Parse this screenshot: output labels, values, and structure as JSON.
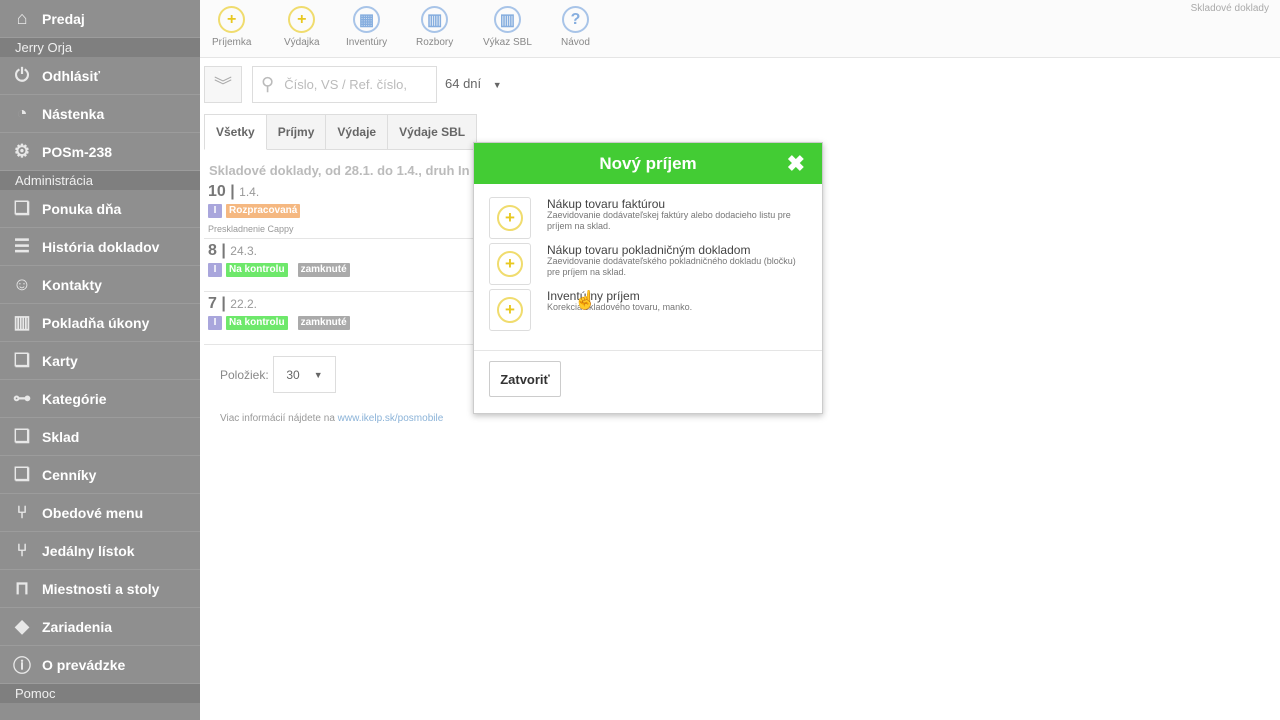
{
  "sidebar": {
    "items": [
      {
        "label": "Predaj",
        "icon": "home-icon"
      },
      {
        "sub": "Jerry Orja"
      },
      {
        "label": "Odhlásiť",
        "icon": "power-icon"
      },
      {
        "label": "Nástenka",
        "icon": "dashboard-icon"
      },
      {
        "label": "POSm-238",
        "icon": "gear-icon"
      },
      {
        "sub": "Administrácia"
      },
      {
        "label": "Ponuka dňa",
        "icon": "boxes-star-icon"
      },
      {
        "label": "História dokladov",
        "icon": "list-icon"
      },
      {
        "label": "Kontakty",
        "icon": "users-icon"
      },
      {
        "label": "Pokladňa úkony",
        "icon": "bars-icon"
      },
      {
        "label": "Karty",
        "icon": "boxes-icon"
      },
      {
        "label": "Kategórie",
        "icon": "tree-icon"
      },
      {
        "label": "Sklad",
        "icon": "boxes-icon"
      },
      {
        "label": "Cenníky",
        "icon": "boxes-icon"
      },
      {
        "label": "Obedové menu",
        "icon": "cutlery-icon"
      },
      {
        "label": "Jedálny lístok",
        "icon": "cutlery-icon"
      },
      {
        "label": "Miestnosti a stoly",
        "icon": "table-icon"
      },
      {
        "label": "Zariadenia",
        "icon": "diamond-icon"
      },
      {
        "label": "O prevádzke",
        "icon": "info-icon"
      },
      {
        "sub": "Pomoc"
      }
    ]
  },
  "toolbar": {
    "buttons": [
      {
        "label": "Príjemka",
        "glyph": "+",
        "color": "yellow"
      },
      {
        "label": "Výdajka",
        "glyph": "+",
        "color": "yellow"
      },
      {
        "label": "Inventúry",
        "glyph": "▦",
        "color": "blue"
      },
      {
        "label": "Rozbory",
        "glyph": "▥",
        "color": "blue"
      },
      {
        "label": "Výkaz SBL",
        "glyph": "▥",
        "color": "blue"
      },
      {
        "label": "Návod",
        "glyph": "?",
        "color": "blue"
      }
    ],
    "page_title": "Skladové doklady"
  },
  "filter": {
    "search_placeholder": "Číslo, VS / Ref. číslo,",
    "period": "64 dní"
  },
  "tabs": [
    "Všetky",
    "Príjmy",
    "Výdaje",
    "Výdaje SBL"
  ],
  "list": {
    "heading": "Skladové doklady, od 28.1. do 1.4., druh In",
    "docs": [
      {
        "number": "10",
        "date": "1.4.",
        "type": "I",
        "status": "Rozpracovaná",
        "status_color": "orange",
        "lock": "",
        "note": "Preskladnenie Cappy"
      },
      {
        "number": "8",
        "date": "24.3.",
        "type": "I",
        "status": "Na kontrolu",
        "status_color": "green",
        "lock": "zamknuté",
        "note": ""
      },
      {
        "number": "7",
        "date": "22.2.",
        "type": "I",
        "status": "Na kontrolu",
        "status_color": "green",
        "lock": "zamknuté",
        "note": ""
      }
    ]
  },
  "pagination": {
    "label": "Položiek:",
    "value": "30"
  },
  "footer": {
    "text": "Viac informácií nájdete na ",
    "link": "www.ikelp.sk/posmobile"
  },
  "modal": {
    "title": "Nový príjem",
    "options": [
      {
        "title": "Nákup tovaru faktúrou",
        "desc": "Zaevidovanie dodávateľskej faktúry alebo dodacieho listu pre príjem na sklad."
      },
      {
        "title": "Nákup tovaru pokladničným dokladom",
        "desc": "Zaevidovanie dodávateľského pokladničného dokladu (bločku) pre príjem na sklad."
      },
      {
        "title": "Inventúrny príjem",
        "desc": "Korekcia skladového tovaru, manko."
      }
    ],
    "close_label": "Zatvoriť"
  }
}
